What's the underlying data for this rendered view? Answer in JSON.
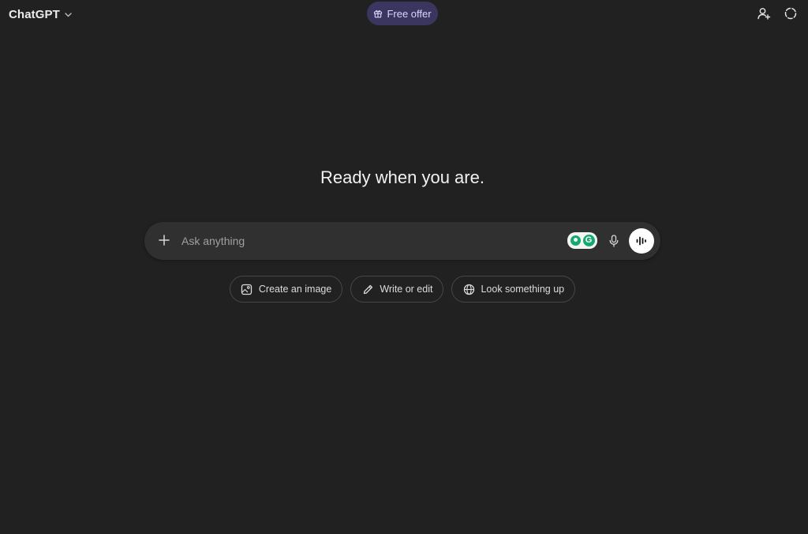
{
  "header": {
    "model_name": "ChatGPT",
    "model_icon": "chevron-down-icon",
    "offer_label": "Free offer",
    "offer_icon": "gift-icon",
    "right_icons": [
      "add-user-icon",
      "temporary-chat-icon"
    ],
    "offer_color": "#3a3660"
  },
  "main": {
    "heading": "Ready when you are."
  },
  "composer": {
    "placeholder": "Ask anything",
    "value": "",
    "grammarly_letter": "G"
  },
  "suggestions": [
    {
      "label": "Create an image",
      "icon": "image-icon"
    },
    {
      "label": "Write or edit",
      "icon": "pencil-icon"
    },
    {
      "label": "Look something up",
      "icon": "globe-icon"
    }
  ],
  "colors": {
    "background": "#212121",
    "composer": "#303030",
    "grammarly_green": "#15a870"
  }
}
